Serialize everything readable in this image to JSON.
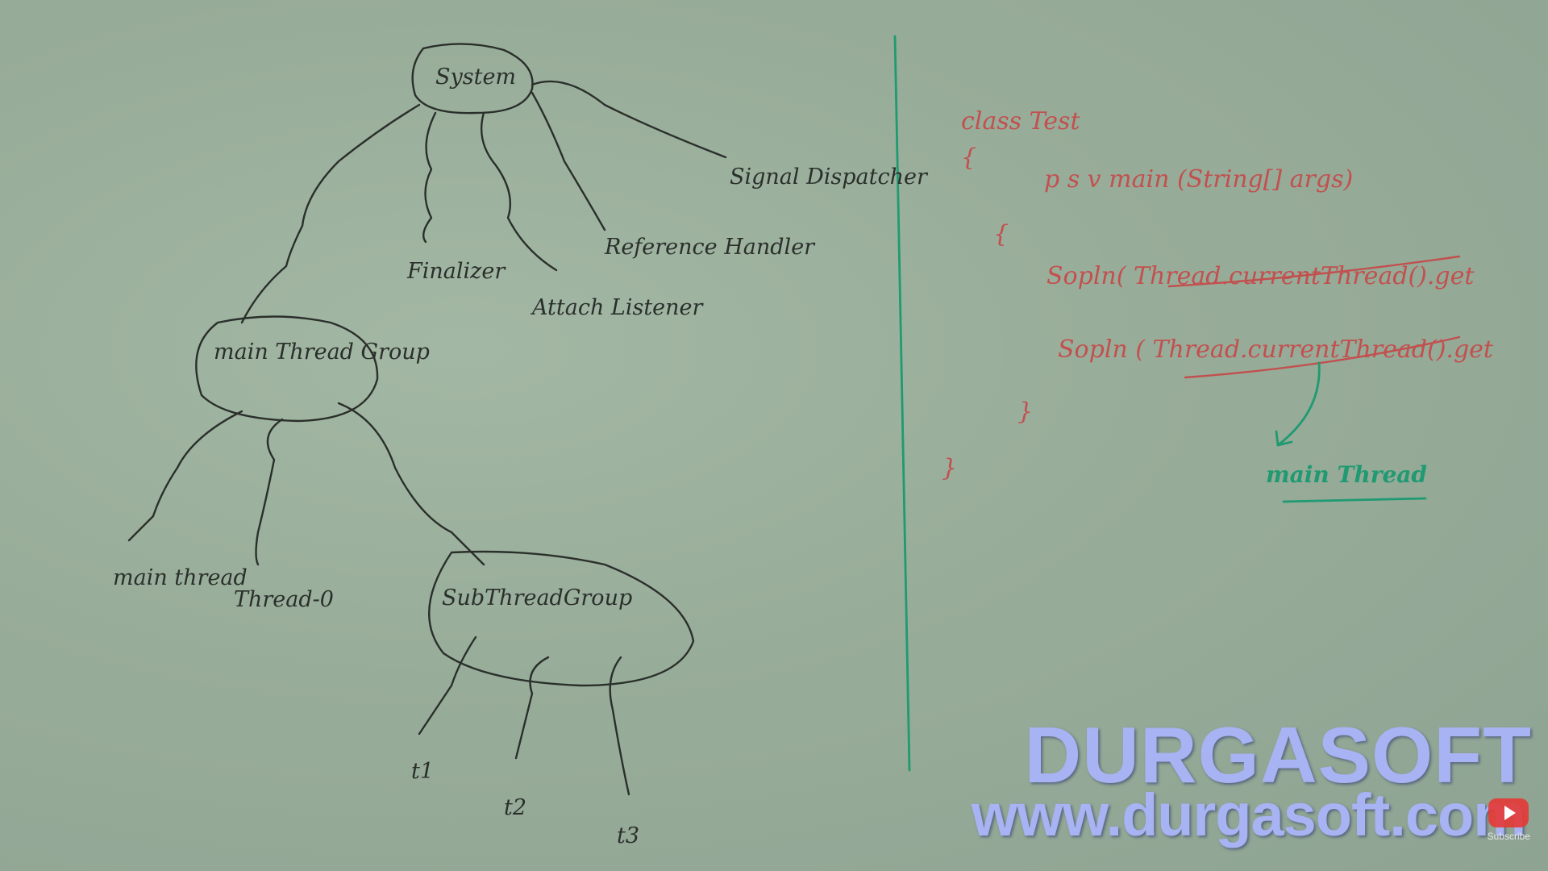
{
  "tree": {
    "root": "System",
    "system_children": [
      "Finalizer",
      "Attach Listener",
      "Reference Handler",
      "Signal Dispatcher"
    ],
    "main_group": "main Thread Group",
    "main_children": [
      "main thread",
      "Thread-0",
      "SubThreadGroup"
    ],
    "sub_children": [
      "t1",
      "t2",
      "t3"
    ]
  },
  "code": {
    "class_line": "class Test",
    "main_line": "p s v main (String[] args)",
    "open_brace": "{",
    "close_brace": "}",
    "line1": "Sopln( Thread.currentThread().get",
    "line2": "Sopln ( Thread.currentThread().get",
    "result": "main Thread"
  },
  "brand": {
    "name": "DURGASOFT",
    "url": "www.durgasoft.com",
    "subscribe": "Subscribe"
  },
  "colors": {
    "board": "#98ad99",
    "marker_black": "#2a2f2b",
    "marker_red": "#c2504f",
    "marker_green": "#1f9a72",
    "brand": "#a7b3f2"
  }
}
